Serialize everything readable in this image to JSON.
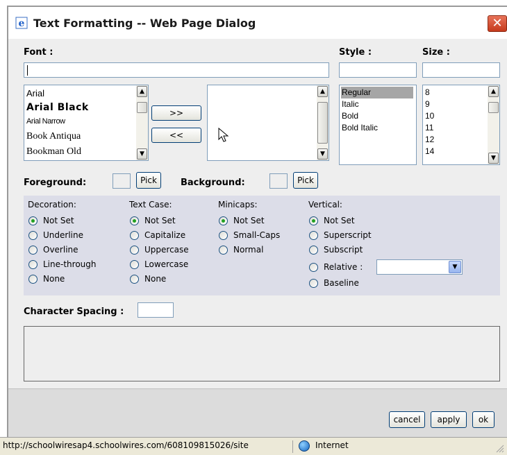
{
  "window": {
    "title": "Text Formatting -- Web Page Dialog",
    "close_glyph": "✕"
  },
  "font": {
    "label": "Font :",
    "input_value": "",
    "list": [
      "Arial",
      "Arial Black",
      "Arial Narrow",
      "Book Antiqua",
      "Bookman Old"
    ],
    "add_button": ">>",
    "remove_button": "<<",
    "selected_list": []
  },
  "style": {
    "label": "Style :",
    "input_value": "",
    "options": [
      "Regular",
      "Italic",
      "Bold",
      "Bold Italic"
    ],
    "selected": "Regular"
  },
  "size": {
    "label": "Size :",
    "input_value": "",
    "options": [
      "8",
      "9",
      "10",
      "11",
      "12",
      "14"
    ]
  },
  "colors": {
    "foreground_label": "Foreground:",
    "background_label": "Background:",
    "pick_label": "Pick"
  },
  "decoration": {
    "title": "Decoration:",
    "options": [
      "Not Set",
      "Underline",
      "Overline",
      "Line-through",
      "None"
    ],
    "checked": 0
  },
  "text_case": {
    "title": "Text Case:",
    "options": [
      "Not Set",
      "Capitalize",
      "Uppercase",
      "Lowercase",
      "None"
    ],
    "checked": 0
  },
  "minicaps": {
    "title": "Minicaps:",
    "options": [
      "Not Set",
      "Small-Caps",
      "Normal"
    ],
    "checked": 0
  },
  "vertical": {
    "title": "Vertical:",
    "options": [
      "Not Set",
      "Superscript",
      "Subscript",
      "Relative :",
      "Baseline"
    ],
    "checked": 0,
    "relative_value": ""
  },
  "character_spacing": {
    "label": "Character Spacing :",
    "value": ""
  },
  "buttons": {
    "cancel": "cancel",
    "apply": "apply",
    "ok": "ok"
  },
  "status": {
    "url": "http://schoolwiresap4.schoolwires.com/608109815026/site",
    "zone": "Internet"
  },
  "colors_theme": {
    "panel": "#dcdde8",
    "dialog": "#eeeeee",
    "highlight": "#a6a6a6",
    "radio_dot": "#21a121"
  }
}
